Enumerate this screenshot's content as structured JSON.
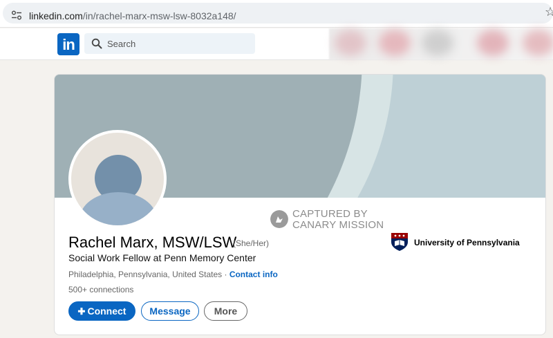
{
  "browser": {
    "url_host": "linkedin.com",
    "url_path": "/in/rachel-marx-msw-lsw-8032a148/"
  },
  "nav": {
    "logo_text": "in",
    "search_placeholder": "Search"
  },
  "watermark": {
    "line1": "CAPTURED BY",
    "line2": "CANARY MISSION"
  },
  "profile": {
    "name": "Rachel Marx, MSW/LSW",
    "pronouns": "(She/Her)",
    "headline": "Social Work Fellow at Penn Memory Center",
    "location": "Philadelphia, Pennsylvania, United States",
    "location_sep": " · ",
    "contact_info": "Contact info",
    "connections_count": "500+",
    "connections_label": " connections",
    "education": "University of Pennsylvania"
  },
  "actions": {
    "connect": "Connect",
    "message": "Message",
    "more": "More"
  },
  "colors": {
    "linkedin_blue": "#0a66c2",
    "penn_red": "#990000",
    "penn_navy": "#011f5b"
  }
}
